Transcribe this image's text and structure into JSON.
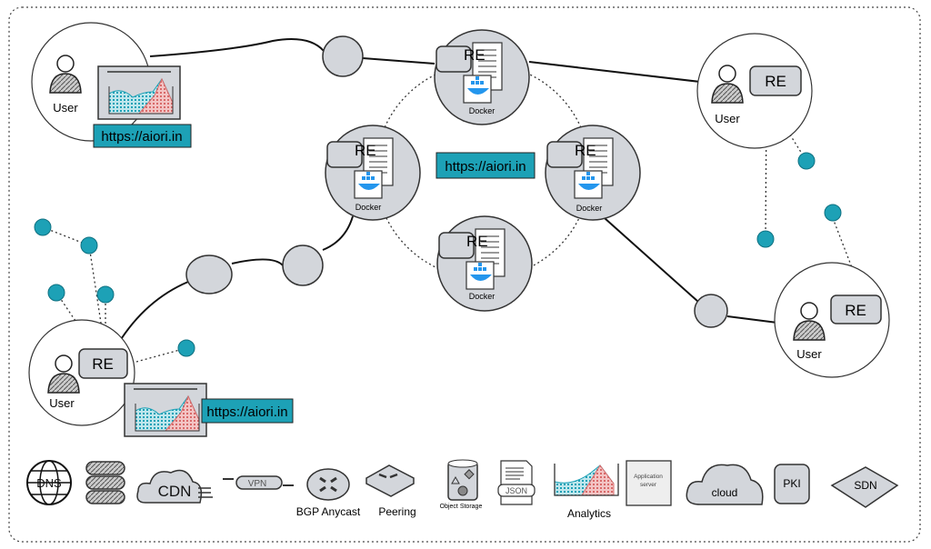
{
  "colors": {
    "accent": "#1da1b6",
    "node_fill": "#d3d6db",
    "outline": "#333333"
  },
  "users": {
    "label": "User"
  },
  "re": {
    "label": "RE"
  },
  "docker": {
    "label": "Docker"
  },
  "url": {
    "label": "https://aiori.in"
  },
  "legend": {
    "dns": "DNS",
    "cdn": "CDN",
    "vpn": "VPN",
    "bgp": "BGP Anycast",
    "peering": "Peering",
    "object_storage": "Object Storage",
    "json": "JSON",
    "analytics": "Analytics",
    "app_server_1": "Application",
    "app_server_2": "server",
    "cloud": "cloud",
    "pki": "PKI",
    "sdn": "SDN"
  }
}
